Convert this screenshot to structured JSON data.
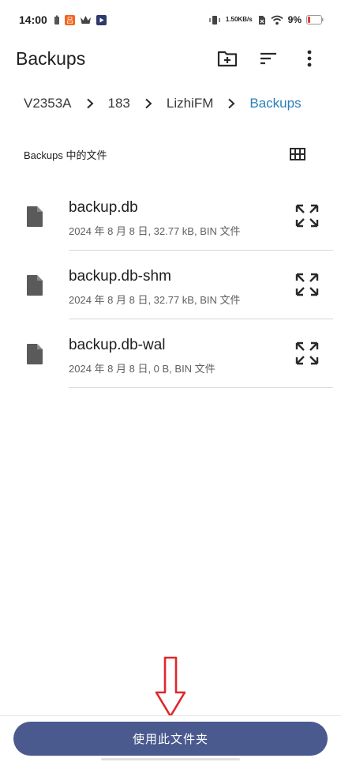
{
  "status_bar": {
    "time": "14:00",
    "net_speed_value": "1.50",
    "net_speed_unit": "KB/s",
    "battery": "9%",
    "icons": [
      "battery-saver-icon",
      "app-notification-icon",
      "crown-icon",
      "play-store-icon",
      "vibrate-icon",
      "net-speed-icon",
      "sim-icon",
      "wifi-icon",
      "battery-low-icon"
    ]
  },
  "header": {
    "title": "Backups",
    "actions": [
      "new-folder-icon",
      "sort-icon",
      "more-vert-icon"
    ]
  },
  "breadcrumb": {
    "items": [
      {
        "label": "V2353A"
      },
      {
        "label": "183"
      },
      {
        "label": "LizhiFM"
      },
      {
        "label": "Backups"
      }
    ]
  },
  "section": {
    "label": "Backups 中的文件",
    "view_toggle_icon": "grid-view-icon"
  },
  "files": [
    {
      "name": "backup.db",
      "meta": "2024 年 8 月 8 日, 32.77 kB, BIN 文件"
    },
    {
      "name": "backup.db-shm",
      "meta": "2024 年 8 月 8 日, 32.77 kB, BIN 文件"
    },
    {
      "name": "backup.db-wal",
      "meta": "2024 年 8 月 8 日, 0 B, BIN 文件"
    }
  ],
  "primary_action": {
    "label": "使用此文件夹"
  },
  "colors": {
    "accent": "#2b7fb8",
    "button": "#4a5a8f",
    "annotation_arrow": "#e0282d"
  }
}
